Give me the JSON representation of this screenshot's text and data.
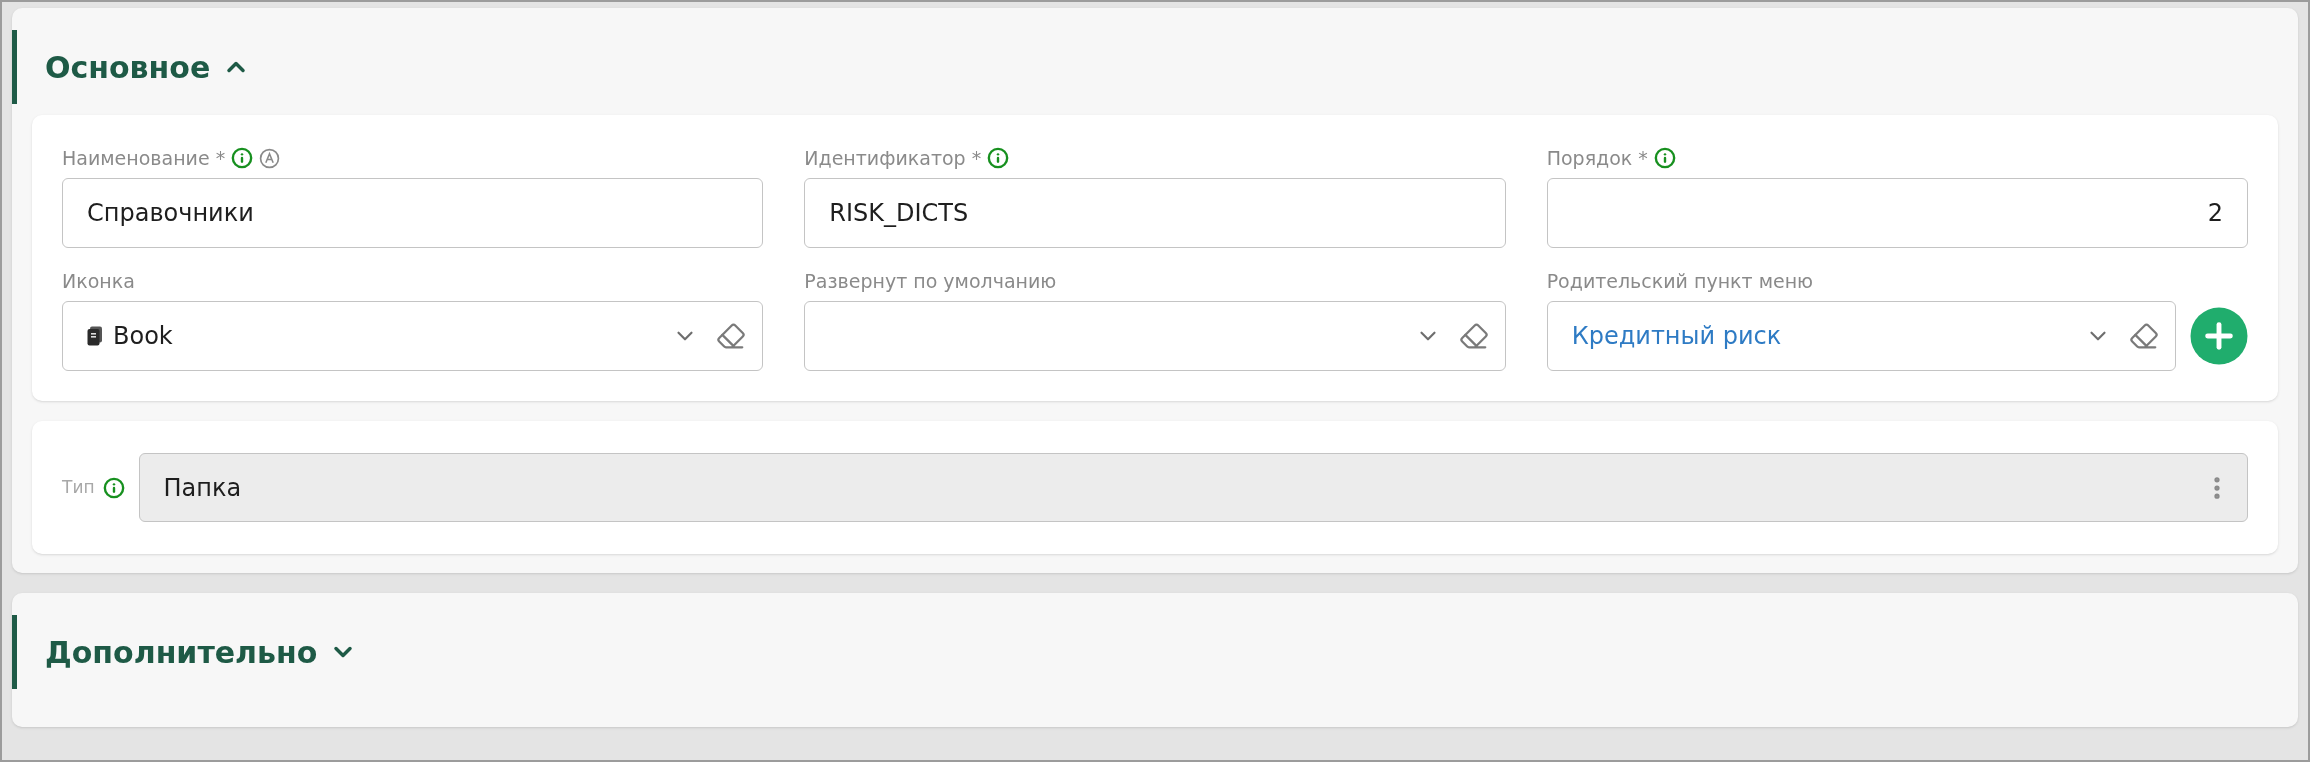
{
  "sections": [
    {
      "title": "Основное",
      "expanded": true,
      "field_rows": [
        [
          {
            "label": "Наименование *",
            "info": true,
            "auto_mark": true,
            "kind": "text",
            "value": "Справочники"
          },
          {
            "label": "Идентификатор *",
            "info": true,
            "auto_mark": false,
            "kind": "text",
            "value": "RISK_DICTS"
          },
          {
            "label": "Порядок *",
            "info": true,
            "auto_mark": false,
            "kind": "number",
            "value": "2"
          }
        ],
        [
          {
            "label": "Иконка",
            "info": false,
            "auto_mark": false,
            "kind": "select",
            "value": "Book",
            "value_icon": true,
            "link": false,
            "add_button": false
          },
          {
            "label": "Развернут по умолчанию",
            "info": false,
            "auto_mark": false,
            "kind": "select",
            "value_icon": false,
            "add_button": false
          },
          {
            "label": "Родительский пункт меню",
            "info": false,
            "auto_mark": false,
            "kind": "select",
            "value": "Кредитный риск",
            "value_icon": false,
            "link": true,
            "add_button": true
          }
        ]
      ],
      "type_row": {
        "label": "Тип",
        "info": true,
        "value": "Папка",
        "disabled": true
      }
    },
    {
      "title": "Дополнительно",
      "expanded": false
    }
  ]
}
